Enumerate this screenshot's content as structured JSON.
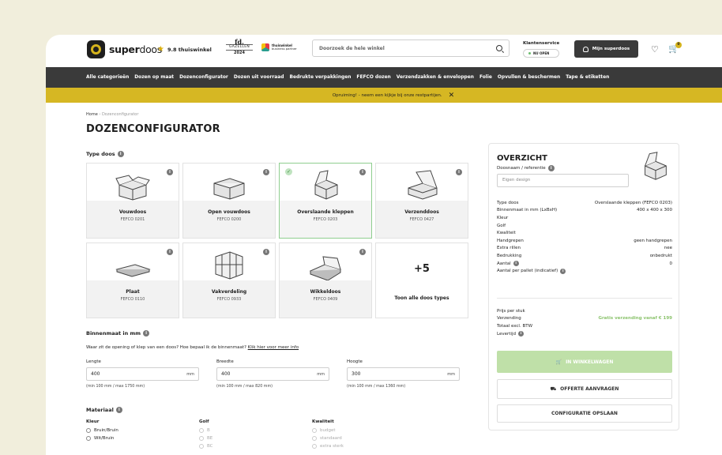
{
  "header": {
    "logo_bold": "super",
    "logo_light": "doos",
    "rating": "9.8 thuiswinkel",
    "gazellen_fd": "fd.",
    "gazellen_name": "GAZELLEN",
    "gazellen_year": "2024",
    "thuiswinkel_title": "thuiswinkel",
    "thuiswinkel_sub": "business partner",
    "search_placeholder": "Doorzoek de hele winkel",
    "service_label": "Klantenservice",
    "service_status": "NU OPEN",
    "account_label": "Mijn superdoos",
    "cart_count": "0"
  },
  "nav": [
    "Alle categorieën",
    "Dozen op maat",
    "Dozenconfigurator",
    "Dozen uit voorraad",
    "Bedrukte verpakkingen",
    "FEFCO dozen",
    "Verzendzakken & enveloppen",
    "Folie",
    "Opvullen & beschermen",
    "Tape & etiketten"
  ],
  "promo": {
    "text": "Opruiming! - neem een kijkje bij onze restpartijen.",
    "close": "✕"
  },
  "breadcrumb": {
    "home": "Home",
    "sep": "›",
    "current": "Dozenconfigurator"
  },
  "page_title": "DOZENCONFIGURATOR",
  "type_section": {
    "label": "Type doos"
  },
  "box_types": [
    {
      "name": "Vouwdoos",
      "code": "FEFCO 0201"
    },
    {
      "name": "Open vouwdoos",
      "code": "FEFCO 0200"
    },
    {
      "name": "Overslaande kleppen",
      "code": "FEFCO 0203"
    },
    {
      "name": "Verzenddoos",
      "code": "FEFCO 0427"
    },
    {
      "name": "Plaat",
      "code": "FEFCO 0110"
    },
    {
      "name": "Vakverdeling",
      "code": "FEFCO 0933"
    },
    {
      "name": "Wikkeldoos",
      "code": "FEFCO 0409"
    }
  ],
  "more_types": {
    "count": "+5",
    "label": "Toon alle doos types"
  },
  "dimensions": {
    "label": "Binnenmaat in mm",
    "desc": "Waar zit de opening of klep van een doos? Hoe bepaal ik de binnenmaat?",
    "link": "Klik hier voor meer info",
    "fields": [
      {
        "label": "Lengte",
        "value": "400",
        "unit": "mm",
        "hint": "(min 100 mm / max 1750 mm)"
      },
      {
        "label": "Breedte",
        "value": "400",
        "unit": "mm",
        "hint": "(min 100 mm / max 820 mm)"
      },
      {
        "label": "Hoogte",
        "value": "300",
        "unit": "mm",
        "hint": "(min 100 mm / max 1360 mm)"
      }
    ]
  },
  "material": {
    "label": "Materiaal",
    "kleur": {
      "label": "Kleur",
      "options": [
        "Bruin/Bruin",
        "Wit/Bruin"
      ]
    },
    "golf": {
      "label": "Golf",
      "options": [
        "B",
        "BE",
        "BC"
      ]
    },
    "kwaliteit": {
      "label": "Kwaliteit",
      "options": [
        "budget",
        "standaard",
        "extra sterk"
      ]
    }
  },
  "overview": {
    "title": "OVERZICHT",
    "ref_label": "Doosnaam / referentie",
    "ref_placeholder": "Eigen design",
    "rows": [
      {
        "k": "Type doos",
        "v": "Overslaande kleppen (FEFCO 0203)"
      },
      {
        "k": "Binnenmaat in mm (LxBxH)",
        "v": "400 x 400 x 300"
      },
      {
        "k": "Kleur",
        "v": ""
      },
      {
        "k": "Golf",
        "v": ""
      },
      {
        "k": "Kwaliteit",
        "v": ""
      },
      {
        "k": "Handgrepen",
        "v": "geen handgrepen"
      },
      {
        "k": "Extra rillen",
        "v": "nee"
      },
      {
        "k": "Bedrukking",
        "v": "onbedrukt"
      },
      {
        "k": "Aantal",
        "v": "0"
      },
      {
        "k": "Aantal per pallet (indicatief)",
        "v": ""
      }
    ],
    "rows2": [
      {
        "k": "Prijs per stuk",
        "v": ""
      },
      {
        "k": "Verzending",
        "v": "Gratis verzending vanaf € 199"
      },
      {
        "k": "Totaal excl. BTW",
        "v": ""
      },
      {
        "k": "Levertijd",
        "v": ""
      }
    ],
    "cart_btn": "IN WINKELWAGEN",
    "quote_btn": "OFFERTE AANVRAGEN",
    "save_btn": "CONFIGURATIE OPSLAAN"
  },
  "colors": {
    "accent": "#d6b723",
    "dark": "#3a3a3a",
    "green": "#8dc46f"
  }
}
